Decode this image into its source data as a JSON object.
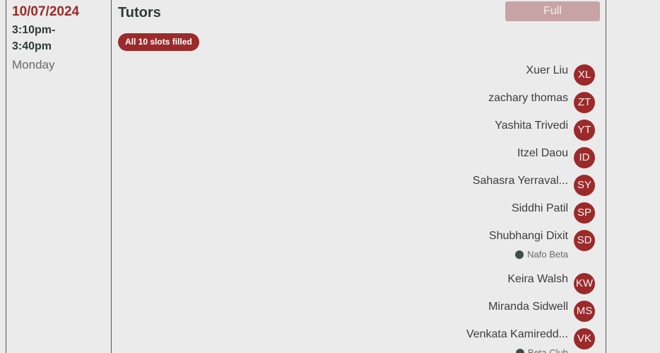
{
  "session": {
    "date": "10/07/2024",
    "time": "3:10pm-\n3:40pm",
    "time_line1": "3:10pm-",
    "time_line2": "3:40pm",
    "weekday": "Monday"
  },
  "panel": {
    "title": "Tutors",
    "status_button": "Full",
    "slots_badge": "All 10 slots filled"
  },
  "tutors": [
    {
      "name": "Xuer Liu",
      "initials": "XL",
      "tag": ""
    },
    {
      "name": "zachary thomas",
      "initials": "ZT",
      "tag": ""
    },
    {
      "name": "Yashita Trivedi",
      "initials": "YT",
      "tag": ""
    },
    {
      "name": "Itzel Daou",
      "initials": "ID",
      "tag": ""
    },
    {
      "name": "Sahasra Yerraval...",
      "initials": "SY",
      "tag": ""
    },
    {
      "name": "Siddhi Patil",
      "initials": "SP",
      "tag": ""
    },
    {
      "name": "Shubhangi Dixit",
      "initials": "SD",
      "tag": "Nafo Beta"
    },
    {
      "name": "Keira Walsh",
      "initials": "KW",
      "tag": ""
    },
    {
      "name": "Miranda Sidwell",
      "initials": "MS",
      "tag": ""
    },
    {
      "name": "Venkata Kamiredd...",
      "initials": "VK",
      "tag": "Beta Club"
    }
  ],
  "colors": {
    "accent": "#9c2a2a",
    "disabled_button": "#c7a3a6",
    "background": "#ebebeb"
  }
}
